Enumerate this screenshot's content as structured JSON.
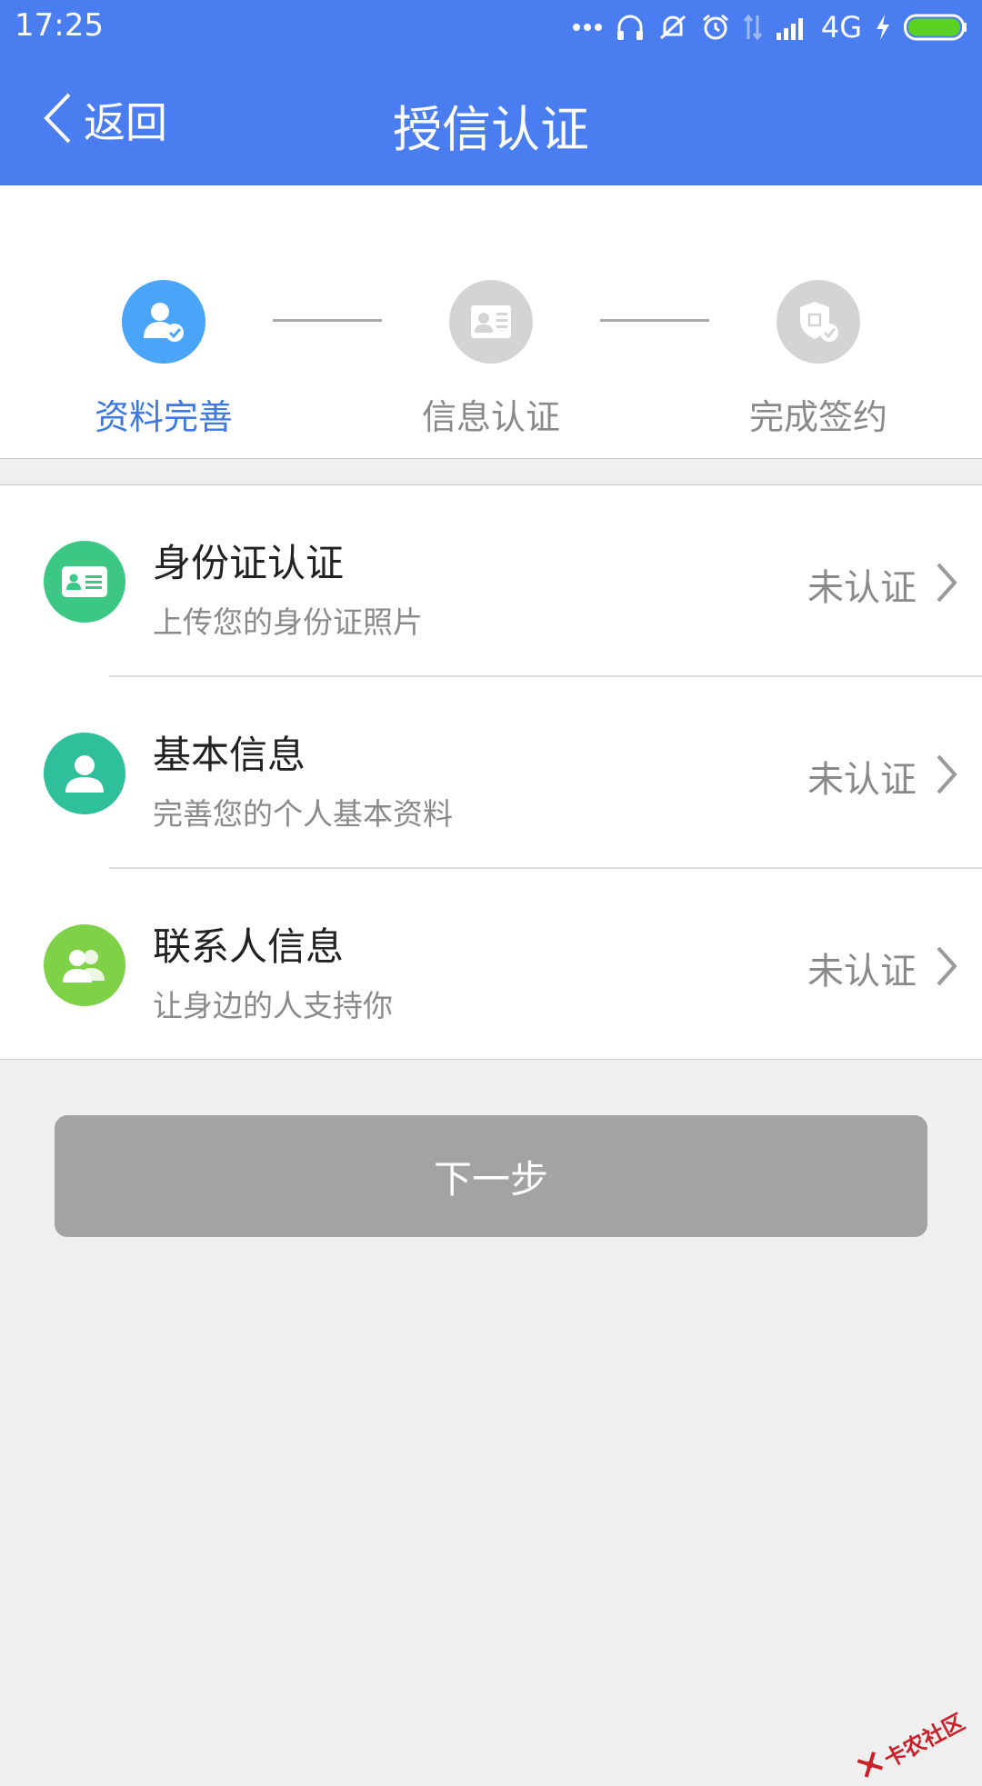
{
  "status_bar": {
    "time": "17:25",
    "network": "4G",
    "icons": [
      "more-icon",
      "headset-icon",
      "mute-icon",
      "alarm-icon",
      "data-arrows-icon",
      "signal-icon",
      "charging-icon",
      "battery-icon"
    ]
  },
  "header": {
    "back_label": "返回",
    "title": "授信认证",
    "background": "#4a7ef0"
  },
  "steps": [
    {
      "label": "资料完善",
      "icon": "user-check-icon",
      "active": true
    },
    {
      "label": "信息认证",
      "icon": "id-card-icon",
      "active": false
    },
    {
      "label": "完成签约",
      "icon": "shield-seal-icon",
      "active": false
    }
  ],
  "list": {
    "items": [
      {
        "title": "身份证认证",
        "subtitle": "上传您的身份证照片",
        "status": "未认证",
        "icon": "id-card-icon",
        "color": "#3cc784"
      },
      {
        "title": "基本信息",
        "subtitle": "完善您的个人基本资料",
        "status": "未认证",
        "icon": "person-icon",
        "color": "#2fbf9a"
      },
      {
        "title": "联系人信息",
        "subtitle": "让身边的人支持你",
        "status": "未认证",
        "icon": "contacts-icon",
        "color": "#7fd147"
      }
    ]
  },
  "next_button": {
    "label": "下一步"
  },
  "watermark": {
    "text": "卡农社区"
  },
  "colors": {
    "accent": "#4a7ef0",
    "step_active": "#4aa4f7",
    "step_inactive": "#d4d4d4",
    "button_disabled": "#a2a4a4"
  }
}
